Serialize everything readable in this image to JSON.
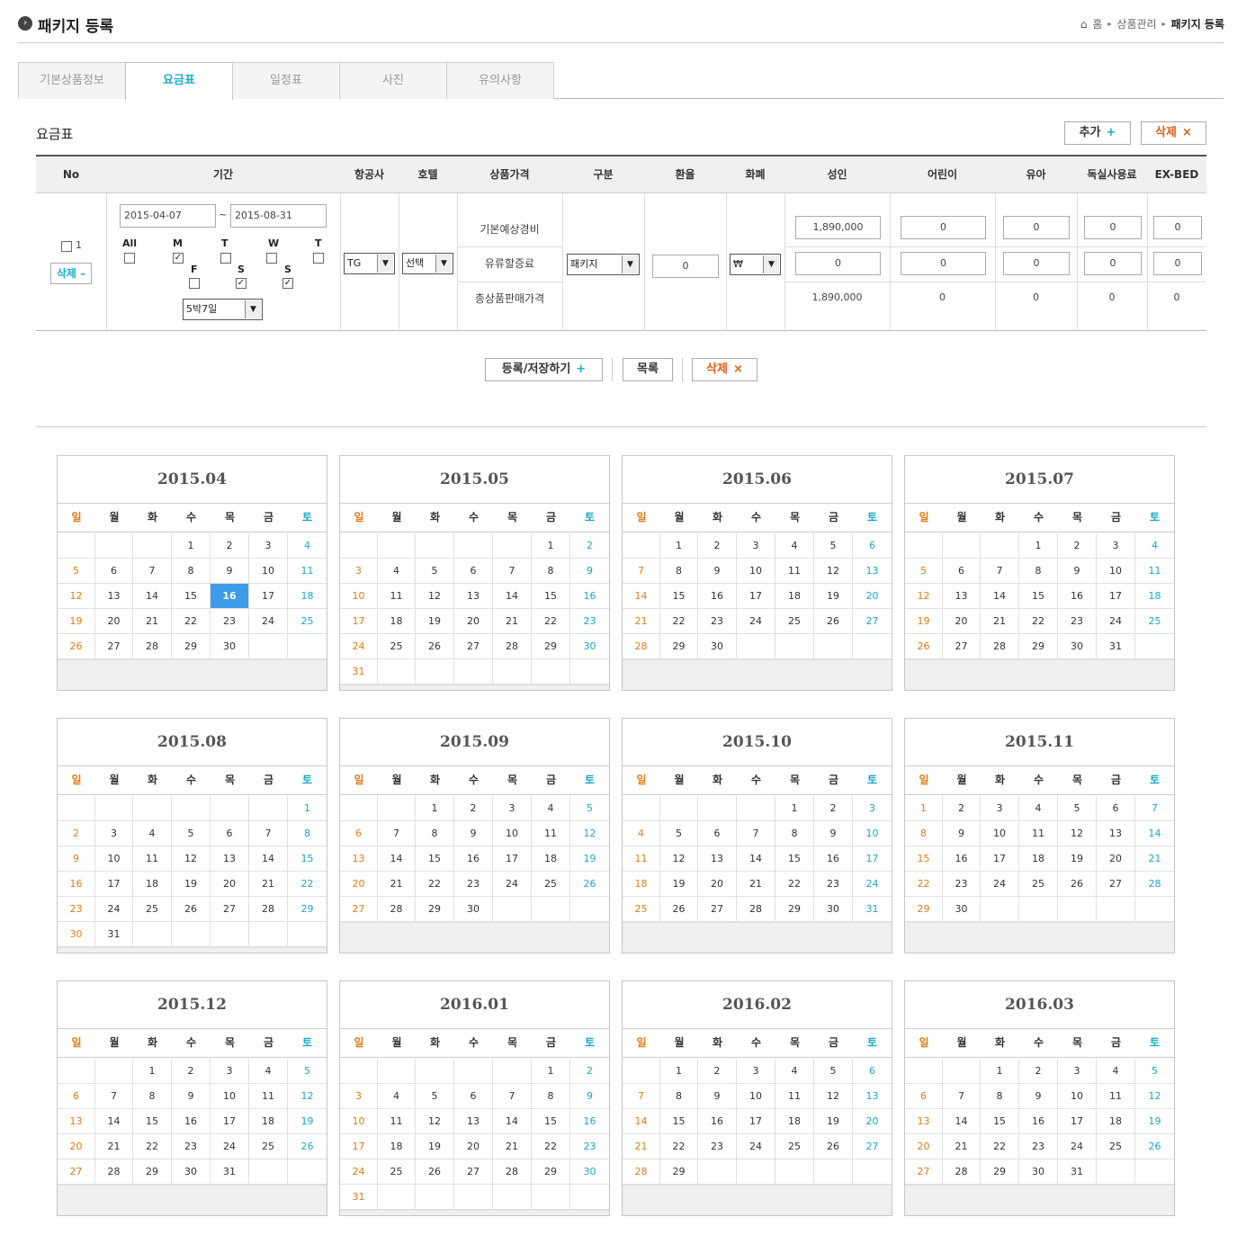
{
  "header": {
    "title": "패키지 등록",
    "breadcrumb": [
      "홈",
      "상품관리",
      "패키지 등록"
    ]
  },
  "tabs": [
    "기본상품정보",
    "요금표",
    "일정표",
    "사진",
    "유의사항"
  ],
  "active_tab": 1,
  "section": {
    "title": "요금표",
    "add_label": "추가",
    "delete_label": "삭제"
  },
  "table": {
    "headers": [
      "No",
      "기간",
      "항공사",
      "호텔",
      "상품가격",
      "구분",
      "환율",
      "화폐",
      "성인",
      "어린이",
      "유아",
      "독실사용료",
      "EX-BED"
    ],
    "row": {
      "no": "1",
      "delete_label": "삭제",
      "date_from": "2015-04-07",
      "date_to": "2015-08-31",
      "tilde": "~",
      "days": [
        "All",
        "M",
        "T",
        "W",
        "T",
        "F",
        "S",
        "S"
      ],
      "days_checked": [
        false,
        true,
        false,
        false,
        false,
        false,
        true,
        true
      ],
      "duration": "5박7일",
      "airline": "TG",
      "hotel": "선택",
      "price_labels": [
        "기본예상경비",
        "유류할증료",
        "총상품판매가격"
      ],
      "category": "패키지",
      "exchange": "0",
      "currency": "₩",
      "adult": [
        "1,890,000",
        "0",
        "1,890,000"
      ],
      "child": [
        "0",
        "0",
        "0"
      ],
      "infant": [
        "0",
        "0",
        "0"
      ],
      "single": [
        "0",
        "0",
        "0"
      ],
      "exbed": [
        "0",
        "0",
        "0"
      ]
    }
  },
  "actions": {
    "save": "등록/저장하기",
    "list": "목록",
    "delete": "삭제"
  },
  "weekdays": [
    "일",
    "월",
    "화",
    "수",
    "목",
    "금",
    "토"
  ],
  "calendars": [
    {
      "title": "2015.04",
      "start": 3,
      "days": 30,
      "highlight": 16
    },
    {
      "title": "2015.05",
      "start": 5,
      "days": 31
    },
    {
      "title": "2015.06",
      "start": 1,
      "days": 30
    },
    {
      "title": "2015.07",
      "start": 3,
      "days": 31
    },
    {
      "title": "2015.08",
      "start": 6,
      "days": 31
    },
    {
      "title": "2015.09",
      "start": 2,
      "days": 30
    },
    {
      "title": "2015.10",
      "start": 4,
      "days": 31
    },
    {
      "title": "2015.11",
      "start": 0,
      "days": 30
    },
    {
      "title": "2015.12",
      "start": 2,
      "days": 31
    },
    {
      "title": "2016.01",
      "start": 5,
      "days": 31
    },
    {
      "title": "2016.02",
      "start": 1,
      "days": 29
    },
    {
      "title": "2016.03",
      "start": 2,
      "days": 31
    }
  ]
}
